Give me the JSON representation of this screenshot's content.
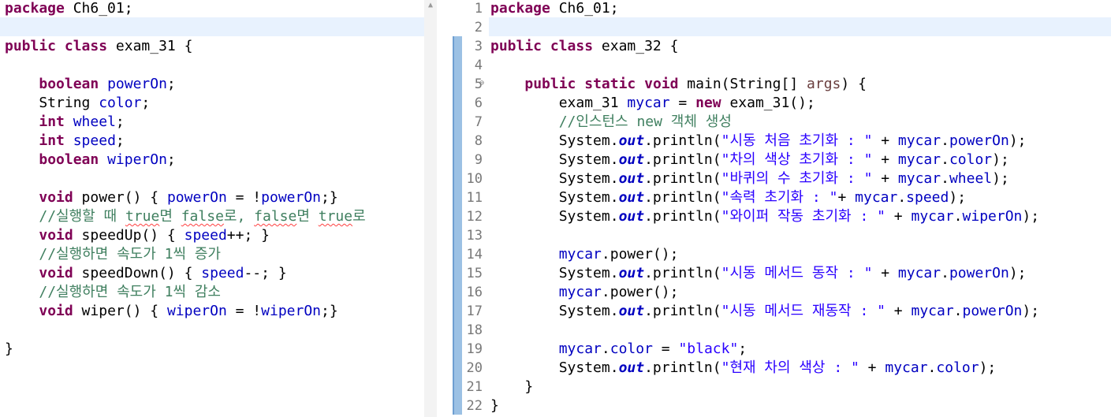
{
  "left_editor": {
    "lines": [
      "package Ch6_01;",
      "",
      "public class exam_31 {",
      "",
      "    boolean powerOn;",
      "    String color;",
      "    int wheel;",
      "    int speed;",
      "    boolean wiperOn;",
      "",
      "    void power() { powerOn = !powerOn;}",
      "    //실행할 때 true면 false로, false면 true로",
      "    void speedUp() { speed++; }",
      "    //실행하면 속도가 1씩 증가",
      "    void speedDown() { speed--; }",
      "    //실행하면 속도가 1씩 감소",
      "    void wiper() { wiperOn = !wiperOn;}",
      "",
      "}"
    ]
  },
  "right_editor": {
    "line_numbers": [
      "1",
      "2",
      "3",
      "4",
      "5",
      "6",
      "7",
      "8",
      "9",
      "10",
      "11",
      "12",
      "13",
      "14",
      "15",
      "16",
      "17",
      "18",
      "19",
      "20",
      "21",
      "22"
    ],
    "fold_icon": "collapse-icon",
    "lines": [
      "package Ch6_01;",
      "",
      "public class exam_32 {",
      "",
      "    public static void main(String[] args) {",
      "        exam_31 mycar = new exam_31();",
      "        //인스턴스 new 객체 생성",
      "        System.out.println(\"시동 처음 초기화 : \" + mycar.powerOn);",
      "        System.out.println(\"차의 색상 초기화 : \" + mycar.color);",
      "        System.out.println(\"바퀴의 수 초기화 : \" + mycar.wheel);",
      "        System.out.println(\"속력 초기화 : \"+ mycar.speed);",
      "        System.out.println(\"와이퍼 작동 초기화 : \" + mycar.wiperOn);",
      "",
      "        mycar.power();",
      "        System.out.println(\"시동 메서드 동작 : \" + mycar.powerOn);",
      "        mycar.power();",
      "        System.out.println(\"시동 메서드 재동작 : \" + mycar.powerOn);",
      "",
      "        mycar.color = \"black\";",
      "        System.out.println(\"현재 차의 색상 : \" + mycar.color);",
      "    }",
      "}"
    ]
  },
  "colors": {
    "keyword": "#7f0055",
    "field": "#0000c0",
    "string": "#2a00ff",
    "comment": "#3f7f5f",
    "current_line": "#e8f2fe",
    "change_bar": "#9cc1e4"
  }
}
